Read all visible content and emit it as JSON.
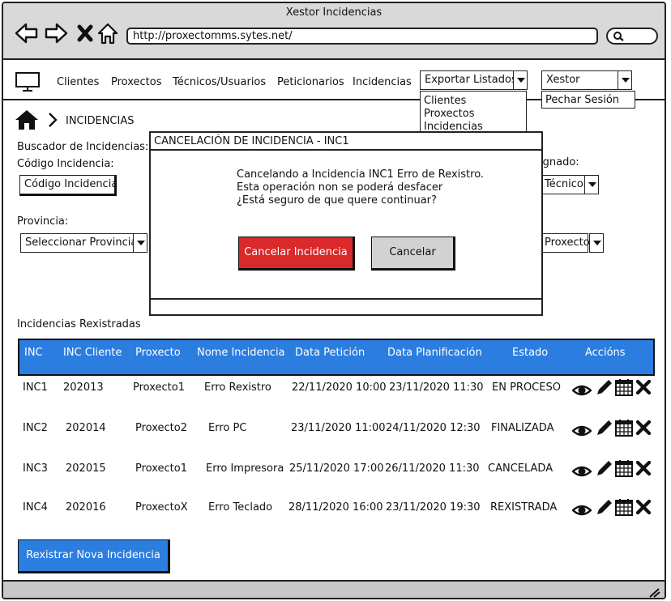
{
  "window": {
    "title": "Xestor Incidencias"
  },
  "browser": {
    "url": "http://proxectomms.sytes.net/"
  },
  "nav": {
    "items": [
      "Clientes",
      "Proxectos",
      "Técnicos/Usuarios",
      "Peticionarios",
      "Incidencias"
    ],
    "export": {
      "label": "Exportar Listados",
      "options": [
        "Clientes",
        "Proxectos",
        "Incidencias"
      ]
    },
    "user": {
      "label": "Xestor",
      "options": [
        "Pechar Sesión"
      ]
    }
  },
  "breadcrumb": {
    "current": "INCIDENCIAS"
  },
  "search": {
    "title": "Buscador de Incidencias:",
    "code_label": "Código Incidencia:",
    "code_value": "Código Incidencia",
    "province_label": "Provincia:",
    "province_value": "Seleccionar Provincia",
    "assigned_label_fragment": "ignado:",
    "technician_value": "Técnico",
    "project_value": "Proxecto"
  },
  "modal": {
    "title": "CANCELACIÓN DE INCIDENCIA - INC1",
    "line1": "Cancelando a Incidencia INC1 Erro de Rexistro.",
    "line2": "Esta operación non se poderá desfacer",
    "line3": "¿Está seguro de que quere continuar?",
    "confirm_label": "Cancelar Incidencia",
    "cancel_label": "Cancelar"
  },
  "table": {
    "caption": "Incidencias Rexistradas",
    "headers": [
      "INC",
      "INC Cliente",
      "Proxecto",
      "Nome Incidencia",
      "Data Petición",
      "Data Planificación",
      "Estado",
      "Accións"
    ],
    "rows": [
      [
        "INC1",
        "202013",
        "Proxecto1",
        "Erro Rexistro",
        "22/11/2020 10:00",
        "23/11/2020 11:30",
        "EN  PROCESO"
      ],
      [
        "INC2",
        "202014",
        "Proxecto2",
        "Erro PC",
        "23/11/2020 11:00",
        "24/11/2020 12:30",
        "FINALIZADA"
      ],
      [
        "INC3",
        "202015",
        "Proxecto1",
        "Erro Impresora",
        "25/11/2020 17:00",
        "26/11/2020 11:30",
        "CANCELADA"
      ],
      [
        "INC4",
        "202016",
        "ProxectoX",
        "Erro Teclado",
        "28/11/2020 16:00",
        "23/11/2020 19:30",
        "REXISTRADA"
      ]
    ],
    "actions": [
      "eye-icon",
      "pencil-icon",
      "calendar-icon",
      "close-icon"
    ]
  },
  "new_button": {
    "label": "Rexistrar Nova Incidencia"
  },
  "colors": {
    "primary": "#2b7de0",
    "danger": "#d9292b",
    "neutral": "#d2d2d2"
  }
}
